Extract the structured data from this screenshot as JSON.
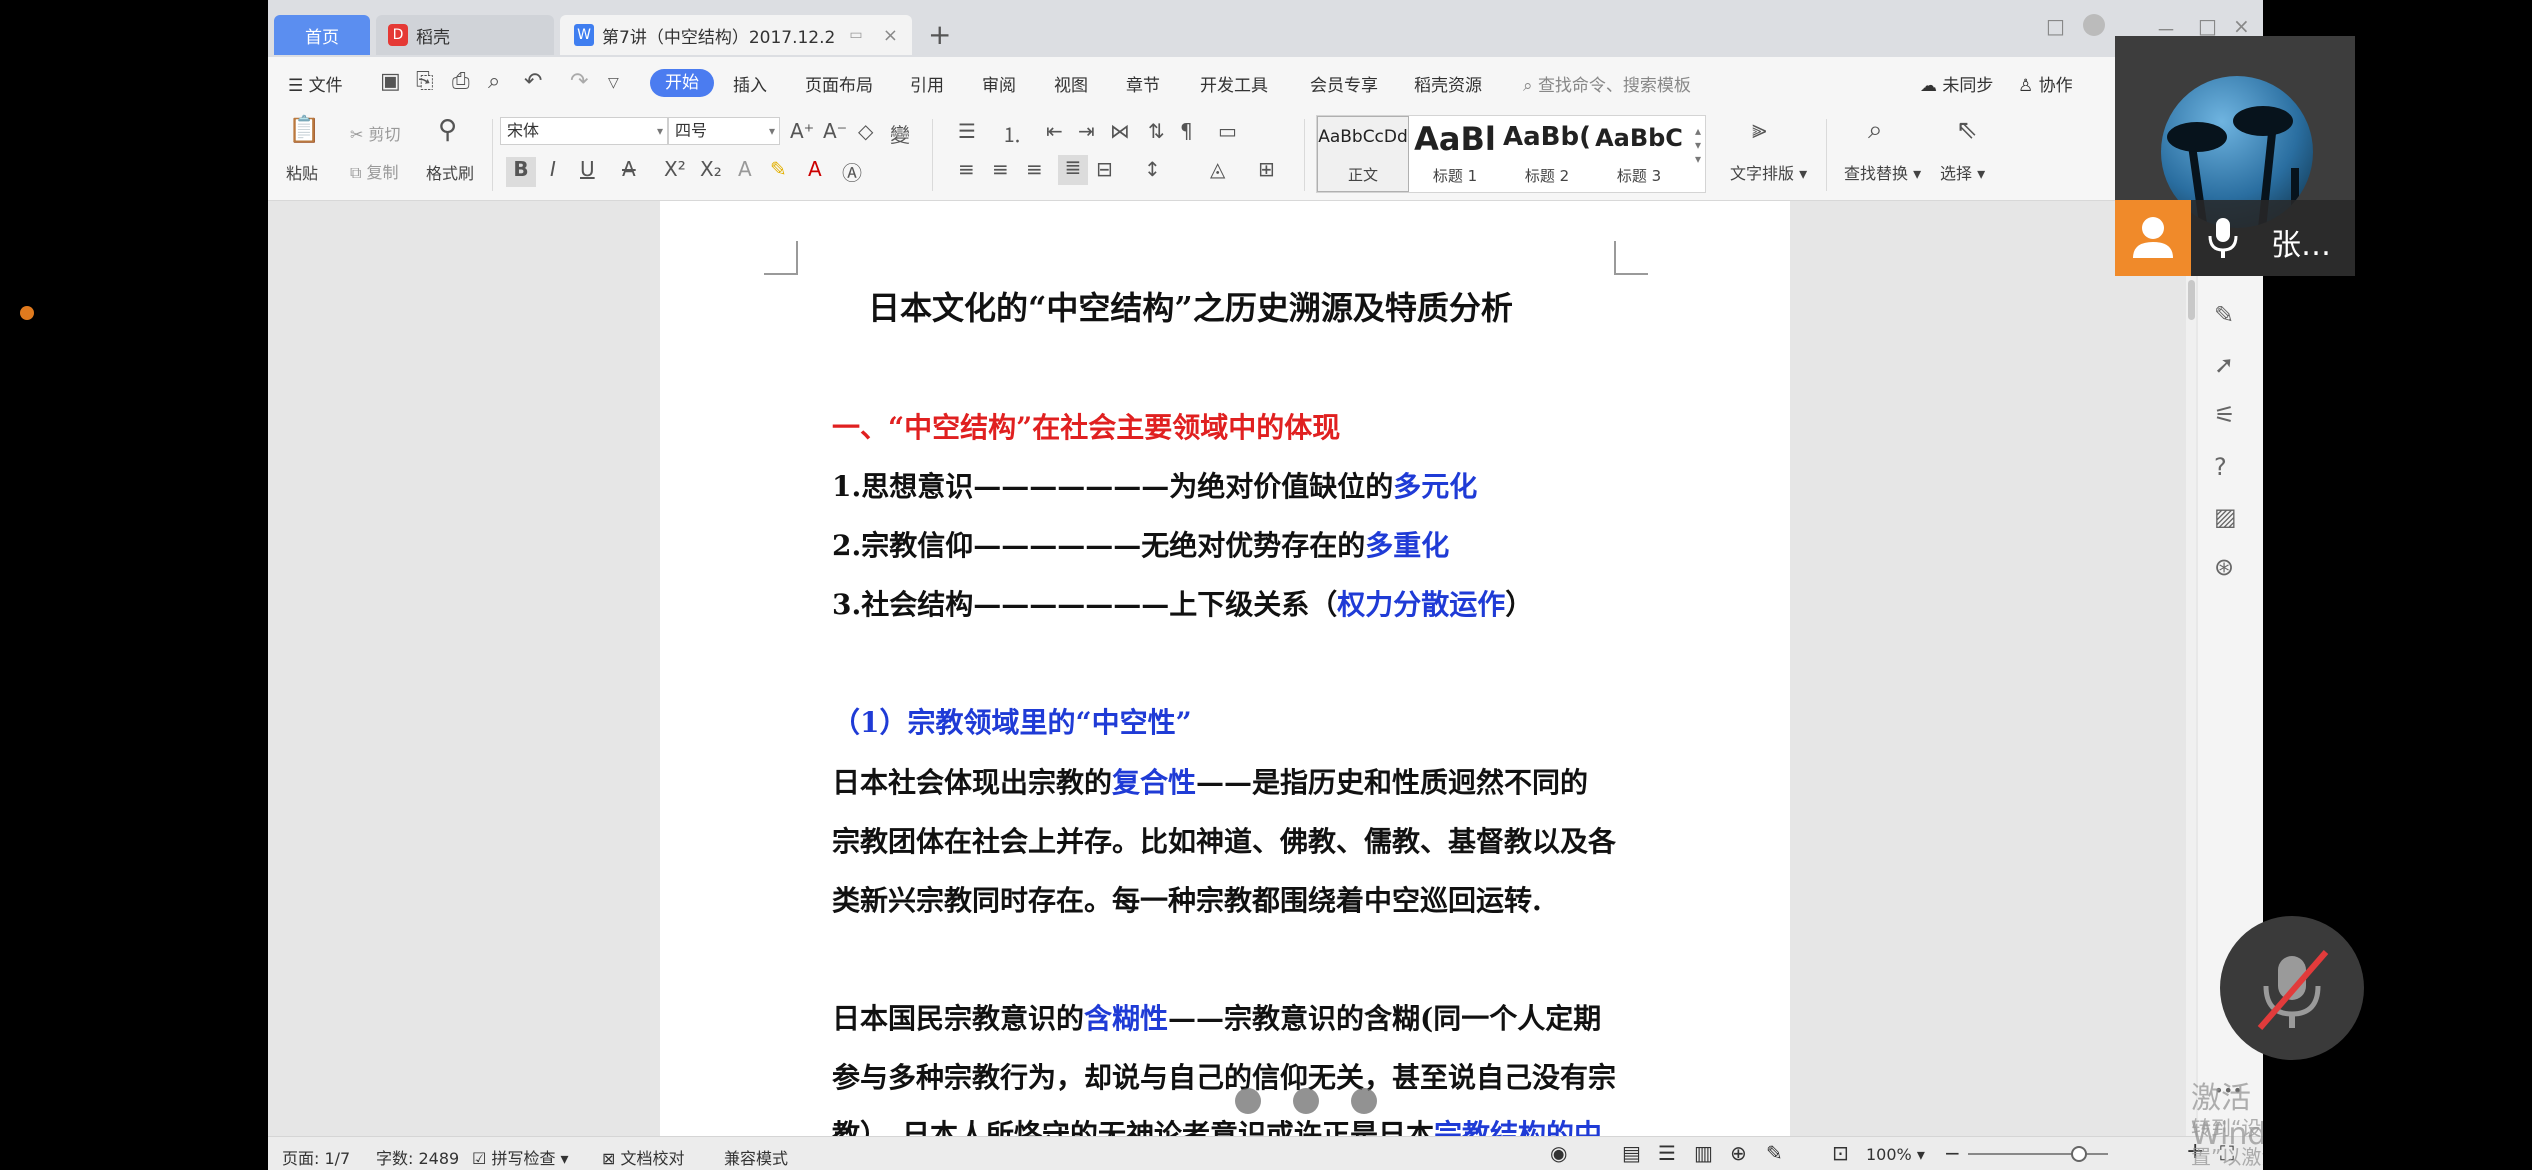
{
  "tabs": {
    "home": "首页",
    "shell": "稻壳",
    "doc": "第7讲（中空结构）2017.12.2",
    "new_tab": "+"
  },
  "window_controls": {
    "restore": "□",
    "min": "－",
    "max": "□",
    "close": "×"
  },
  "menu": {
    "file": "文件",
    "items": [
      "开始",
      "插入",
      "页面布局",
      "引用",
      "审阅",
      "视图",
      "章节",
      "开发工具",
      "会员专享",
      "稻壳资源"
    ],
    "search_placeholder": "查找命令、搜索模板",
    "sync": "未同步",
    "collab": "协作"
  },
  "ribbon": {
    "paste": "粘贴",
    "cut": "剪切",
    "copy": "复制",
    "format_painter": "格式刷",
    "font_name": "宋体",
    "font_size": "四号",
    "styles": [
      {
        "sample": "AaBbCcDd",
        "name": "正文"
      },
      {
        "sample": "AaBl",
        "name": "标题 1"
      },
      {
        "sample": "AaBb(",
        "name": "标题 2"
      },
      {
        "sample": "AaBbC",
        "name": "标题 3"
      }
    ],
    "text_layout": "文字排版",
    "find_replace": "查找替换",
    "select": "选择"
  },
  "document": {
    "title": "日本文化的“中空结构”之历史溯源及特质分析",
    "heading1": "一、“中空结构”在社会主要领域中的体现",
    "item1_a": "1.思想意识———————为绝对价值缺位的",
    "item1_b": "多元化",
    "item2_a": "2.宗教信仰——————无绝对优势存在的",
    "item2_b": "多重化",
    "item3_a": "3.社会结构———————上下级关系（",
    "item3_b": "权力分散运作",
    "item3_c": "）",
    "sub1": "（1）宗教领域里的“中空性”",
    "p1_l1_a": "日本社会体现出宗教的",
    "p1_l1_b": "复合性",
    "p1_l1_c": "——是指历史和性质迥然不同的",
    "p1_l2": "宗教团体在社会上并存。比如神道、佛教、儒教、基督教以及各",
    "p1_l3": "类新兴宗教同时存在。每一种宗教都围绕着中空巡回运转.",
    "p2_l1_a": "日本国民宗教意识的",
    "p2_l1_b": "含糊性",
    "p2_l1_c": "——宗教意识的含糊(同一个人定期",
    "p2_l2": "参与多种宗教行为，却说与自己的信仰无关，甚至说自己没有宗",
    "p2_l3_a": "教）。日本人所恪守的无神论者意识或许正是日本",
    "p2_l3_b": "宗教结构的中"
  },
  "status": {
    "page": "页面: 1/7",
    "words": "字数: 2489",
    "spell": "拼写检查",
    "proof": "文档校对",
    "compat": "兼容模式",
    "zoom": "100%"
  },
  "watermark": {
    "line1": "激活 Windows",
    "line2": "转到“设置”以激活 Windows。"
  },
  "video": {
    "name": "张…"
  },
  "colors": {
    "accent": "#4b7cf0",
    "heading_red": "#e02020",
    "highlight_blue": "#1f3bd6",
    "user_orange": "#f08a2a"
  }
}
